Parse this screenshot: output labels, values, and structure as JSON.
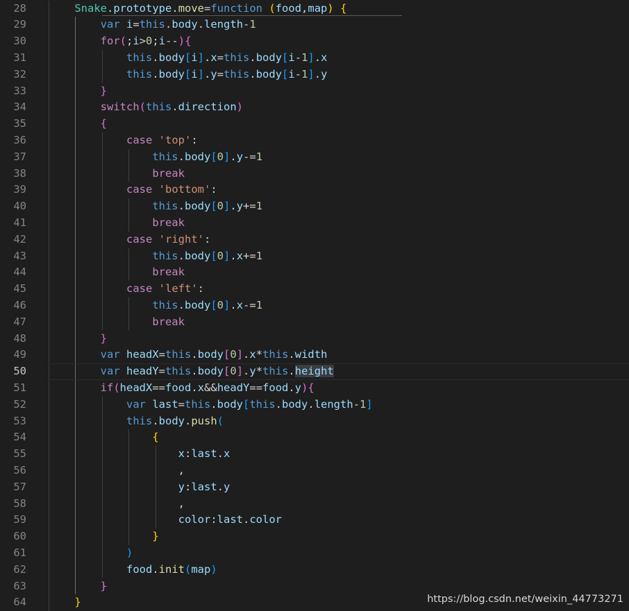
{
  "editor": {
    "current_line": "50",
    "lines": [
      {
        "num": "28",
        "tokens": [
          [
            "    ",
            "op"
          ],
          [
            "Snake",
            "cls"
          ],
          [
            ".",
            "op"
          ],
          [
            "prototype",
            "var"
          ],
          [
            ".",
            "op"
          ],
          [
            "move",
            "fn"
          ],
          [
            "=",
            "op"
          ],
          [
            "function",
            "kw"
          ],
          [
            " ",
            "op"
          ],
          [
            "(",
            "b1"
          ],
          [
            "food",
            "var"
          ],
          [
            ",",
            "op"
          ],
          [
            "map",
            "var"
          ],
          [
            ")",
            "b1"
          ],
          [
            " ",
            "op"
          ],
          [
            "{",
            "b1"
          ]
        ]
      },
      {
        "num": "29",
        "tokens": [
          [
            "        ",
            "op"
          ],
          [
            "var",
            "kw"
          ],
          [
            " ",
            "op"
          ],
          [
            "i",
            "var"
          ],
          [
            "=",
            "op"
          ],
          [
            "this",
            "kw"
          ],
          [
            ".",
            "op"
          ],
          [
            "body",
            "var"
          ],
          [
            ".",
            "op"
          ],
          [
            "length",
            "var"
          ],
          [
            "-",
            "op"
          ],
          [
            "1",
            "num"
          ]
        ]
      },
      {
        "num": "30",
        "tokens": [
          [
            "        ",
            "op"
          ],
          [
            "for",
            "ctl"
          ],
          [
            "(",
            "b2"
          ],
          [
            ";",
            "op"
          ],
          [
            "i",
            "var"
          ],
          [
            ">",
            "op"
          ],
          [
            "0",
            "num"
          ],
          [
            ";",
            "op"
          ],
          [
            "i",
            "var"
          ],
          [
            "--",
            "op"
          ],
          [
            ")",
            "b2"
          ],
          [
            "{",
            "b2"
          ]
        ]
      },
      {
        "num": "31",
        "tokens": [
          [
            "            ",
            "op"
          ],
          [
            "this",
            "kw"
          ],
          [
            ".",
            "op"
          ],
          [
            "body",
            "var"
          ],
          [
            "[",
            "b3"
          ],
          [
            "i",
            "var"
          ],
          [
            "]",
            "b3"
          ],
          [
            ".",
            "op"
          ],
          [
            "x",
            "var"
          ],
          [
            "=",
            "op"
          ],
          [
            "this",
            "kw"
          ],
          [
            ".",
            "op"
          ],
          [
            "body",
            "var"
          ],
          [
            "[",
            "b3"
          ],
          [
            "i",
            "var"
          ],
          [
            "-",
            "op"
          ],
          [
            "1",
            "num"
          ],
          [
            "]",
            "b3"
          ],
          [
            ".",
            "op"
          ],
          [
            "x",
            "var"
          ]
        ]
      },
      {
        "num": "32",
        "tokens": [
          [
            "            ",
            "op"
          ],
          [
            "this",
            "kw"
          ],
          [
            ".",
            "op"
          ],
          [
            "body",
            "var"
          ],
          [
            "[",
            "b3"
          ],
          [
            "i",
            "var"
          ],
          [
            "]",
            "b3"
          ],
          [
            ".",
            "op"
          ],
          [
            "y",
            "var"
          ],
          [
            "=",
            "op"
          ],
          [
            "this",
            "kw"
          ],
          [
            ".",
            "op"
          ],
          [
            "body",
            "var"
          ],
          [
            "[",
            "b3"
          ],
          [
            "i",
            "var"
          ],
          [
            "-",
            "op"
          ],
          [
            "1",
            "num"
          ],
          [
            "]",
            "b3"
          ],
          [
            ".",
            "op"
          ],
          [
            "y",
            "var"
          ]
        ]
      },
      {
        "num": "33",
        "tokens": [
          [
            "        ",
            "op"
          ],
          [
            "}",
            "b2"
          ]
        ]
      },
      {
        "num": "34",
        "tokens": [
          [
            "        ",
            "op"
          ],
          [
            "switch",
            "ctl"
          ],
          [
            "(",
            "b2"
          ],
          [
            "this",
            "kw"
          ],
          [
            ".",
            "op"
          ],
          [
            "direction",
            "var"
          ],
          [
            ")",
            "b2"
          ]
        ]
      },
      {
        "num": "35",
        "tokens": [
          [
            "        ",
            "op"
          ],
          [
            "{",
            "b2"
          ]
        ]
      },
      {
        "num": "36",
        "tokens": [
          [
            "            ",
            "op"
          ],
          [
            "case",
            "ctl"
          ],
          [
            " ",
            "op"
          ],
          [
            "'top'",
            "str"
          ],
          [
            ":",
            "op"
          ]
        ]
      },
      {
        "num": "37",
        "tokens": [
          [
            "                ",
            "op"
          ],
          [
            "this",
            "kw"
          ],
          [
            ".",
            "op"
          ],
          [
            "body",
            "var"
          ],
          [
            "[",
            "b3"
          ],
          [
            "0",
            "num"
          ],
          [
            "]",
            "b3"
          ],
          [
            ".",
            "op"
          ],
          [
            "y",
            "var"
          ],
          [
            "-=",
            "op"
          ],
          [
            "1",
            "num"
          ]
        ]
      },
      {
        "num": "38",
        "tokens": [
          [
            "                ",
            "op"
          ],
          [
            "break",
            "ctl"
          ]
        ]
      },
      {
        "num": "39",
        "tokens": [
          [
            "            ",
            "op"
          ],
          [
            "case",
            "ctl"
          ],
          [
            " ",
            "op"
          ],
          [
            "'bottom'",
            "str"
          ],
          [
            ":",
            "op"
          ]
        ]
      },
      {
        "num": "40",
        "tokens": [
          [
            "                ",
            "op"
          ],
          [
            "this",
            "kw"
          ],
          [
            ".",
            "op"
          ],
          [
            "body",
            "var"
          ],
          [
            "[",
            "b3"
          ],
          [
            "0",
            "num"
          ],
          [
            "]",
            "b3"
          ],
          [
            ".",
            "op"
          ],
          [
            "y",
            "var"
          ],
          [
            "+=",
            "op"
          ],
          [
            "1",
            "num"
          ]
        ]
      },
      {
        "num": "41",
        "tokens": [
          [
            "                ",
            "op"
          ],
          [
            "break",
            "ctl"
          ]
        ]
      },
      {
        "num": "42",
        "tokens": [
          [
            "            ",
            "op"
          ],
          [
            "case",
            "ctl"
          ],
          [
            " ",
            "op"
          ],
          [
            "'right'",
            "str"
          ],
          [
            ":",
            "op"
          ]
        ]
      },
      {
        "num": "43",
        "tokens": [
          [
            "                ",
            "op"
          ],
          [
            "this",
            "kw"
          ],
          [
            ".",
            "op"
          ],
          [
            "body",
            "var"
          ],
          [
            "[",
            "b3"
          ],
          [
            "0",
            "num"
          ],
          [
            "]",
            "b3"
          ],
          [
            ".",
            "op"
          ],
          [
            "x",
            "var"
          ],
          [
            "+=",
            "op"
          ],
          [
            "1",
            "num"
          ]
        ]
      },
      {
        "num": "44",
        "tokens": [
          [
            "                ",
            "op"
          ],
          [
            "break",
            "ctl"
          ]
        ]
      },
      {
        "num": "45",
        "tokens": [
          [
            "            ",
            "op"
          ],
          [
            "case",
            "ctl"
          ],
          [
            " ",
            "op"
          ],
          [
            "'left'",
            "str"
          ],
          [
            ":",
            "op"
          ]
        ]
      },
      {
        "num": "46",
        "tokens": [
          [
            "                ",
            "op"
          ],
          [
            "this",
            "kw"
          ],
          [
            ".",
            "op"
          ],
          [
            "body",
            "var"
          ],
          [
            "[",
            "b3"
          ],
          [
            "0",
            "num"
          ],
          [
            "]",
            "b3"
          ],
          [
            ".",
            "op"
          ],
          [
            "x",
            "var"
          ],
          [
            "-=",
            "op"
          ],
          [
            "1",
            "num"
          ]
        ]
      },
      {
        "num": "47",
        "tokens": [
          [
            "                ",
            "op"
          ],
          [
            "break",
            "ctl"
          ]
        ]
      },
      {
        "num": "48",
        "tokens": [
          [
            "        ",
            "op"
          ],
          [
            "}",
            "b2"
          ]
        ]
      },
      {
        "num": "49",
        "tokens": [
          [
            "        ",
            "op"
          ],
          [
            "var",
            "kw"
          ],
          [
            " ",
            "op"
          ],
          [
            "headX",
            "var"
          ],
          [
            "=",
            "op"
          ],
          [
            "this",
            "kw"
          ],
          [
            ".",
            "op"
          ],
          [
            "body",
            "var"
          ],
          [
            "[",
            "b2"
          ],
          [
            "0",
            "num"
          ],
          [
            "]",
            "b2"
          ],
          [
            ".",
            "op"
          ],
          [
            "x",
            "var"
          ],
          [
            "*",
            "op"
          ],
          [
            "this",
            "kw"
          ],
          [
            ".",
            "op"
          ],
          [
            "width",
            "var"
          ]
        ]
      },
      {
        "num": "50",
        "tokens": [
          [
            "        ",
            "op"
          ],
          [
            "var",
            "kw"
          ],
          [
            " ",
            "op"
          ],
          [
            "headY",
            "var"
          ],
          [
            "=",
            "op"
          ],
          [
            "this",
            "kw"
          ],
          [
            ".",
            "op"
          ],
          [
            "body",
            "var"
          ],
          [
            "[",
            "b2"
          ],
          [
            "0",
            "num"
          ],
          [
            "]",
            "b2"
          ],
          [
            ".",
            "op"
          ],
          [
            "y",
            "var"
          ],
          [
            "*",
            "op"
          ],
          [
            "this",
            "kw"
          ],
          [
            ".",
            "op"
          ],
          [
            "height",
            "hl"
          ]
        ]
      },
      {
        "num": "51",
        "tokens": [
          [
            "        ",
            "op"
          ],
          [
            "if",
            "ctl"
          ],
          [
            "(",
            "b2"
          ],
          [
            "headX",
            "var"
          ],
          [
            "==",
            "op"
          ],
          [
            "food",
            "var"
          ],
          [
            ".",
            "op"
          ],
          [
            "x",
            "var"
          ],
          [
            "&&",
            "op"
          ],
          [
            "headY",
            "var"
          ],
          [
            "==",
            "op"
          ],
          [
            "food",
            "var"
          ],
          [
            ".",
            "op"
          ],
          [
            "y",
            "var"
          ],
          [
            ")",
            "b2"
          ],
          [
            "{",
            "b2"
          ]
        ]
      },
      {
        "num": "52",
        "tokens": [
          [
            "            ",
            "op"
          ],
          [
            "var",
            "kw"
          ],
          [
            " ",
            "op"
          ],
          [
            "last",
            "var"
          ],
          [
            "=",
            "op"
          ],
          [
            "this",
            "kw"
          ],
          [
            ".",
            "op"
          ],
          [
            "body",
            "var"
          ],
          [
            "[",
            "b3"
          ],
          [
            "this",
            "kw"
          ],
          [
            ".",
            "op"
          ],
          [
            "body",
            "var"
          ],
          [
            ".",
            "op"
          ],
          [
            "length",
            "var"
          ],
          [
            "-",
            "op"
          ],
          [
            "1",
            "num"
          ],
          [
            "]",
            "b3"
          ]
        ]
      },
      {
        "num": "53",
        "tokens": [
          [
            "            ",
            "op"
          ],
          [
            "this",
            "kw"
          ],
          [
            ".",
            "op"
          ],
          [
            "body",
            "var"
          ],
          [
            ".",
            "op"
          ],
          [
            "push",
            "fn"
          ],
          [
            "(",
            "b3"
          ]
        ]
      },
      {
        "num": "54",
        "tokens": [
          [
            "                ",
            "op"
          ],
          [
            "{",
            "b1"
          ]
        ]
      },
      {
        "num": "55",
        "tokens": [
          [
            "                    ",
            "op"
          ],
          [
            "x",
            "var"
          ],
          [
            ":",
            "op"
          ],
          [
            "last",
            "var"
          ],
          [
            ".",
            "op"
          ],
          [
            "x",
            "var"
          ]
        ]
      },
      {
        "num": "56",
        "tokens": [
          [
            "                    ",
            "op"
          ],
          [
            ",",
            "op"
          ]
        ]
      },
      {
        "num": "57",
        "tokens": [
          [
            "                    ",
            "op"
          ],
          [
            "y",
            "var"
          ],
          [
            ":",
            "op"
          ],
          [
            "last",
            "var"
          ],
          [
            ".",
            "op"
          ],
          [
            "y",
            "var"
          ]
        ]
      },
      {
        "num": "58",
        "tokens": [
          [
            "                    ",
            "op"
          ],
          [
            ",",
            "op"
          ]
        ]
      },
      {
        "num": "59",
        "tokens": [
          [
            "                    ",
            "op"
          ],
          [
            "color",
            "var"
          ],
          [
            ":",
            "op"
          ],
          [
            "last",
            "var"
          ],
          [
            ".",
            "op"
          ],
          [
            "color",
            "var"
          ]
        ]
      },
      {
        "num": "60",
        "tokens": [
          [
            "                ",
            "op"
          ],
          [
            "}",
            "b1"
          ]
        ]
      },
      {
        "num": "61",
        "tokens": [
          [
            "            ",
            "op"
          ],
          [
            ")",
            "b3"
          ]
        ]
      },
      {
        "num": "62",
        "tokens": [
          [
            "            ",
            "op"
          ],
          [
            "food",
            "var"
          ],
          [
            ".",
            "op"
          ],
          [
            "init",
            "fn"
          ],
          [
            "(",
            "b3"
          ],
          [
            "map",
            "var"
          ],
          [
            ")",
            "b3"
          ]
        ]
      },
      {
        "num": "63",
        "tokens": [
          [
            "        ",
            "op"
          ],
          [
            "}",
            "b2"
          ]
        ]
      },
      {
        "num": "64",
        "tokens": [
          [
            "    ",
            "op"
          ],
          [
            "}",
            "b1"
          ]
        ]
      }
    ]
  },
  "watermark": "https://blog.csdn.net/weixin_44773271"
}
